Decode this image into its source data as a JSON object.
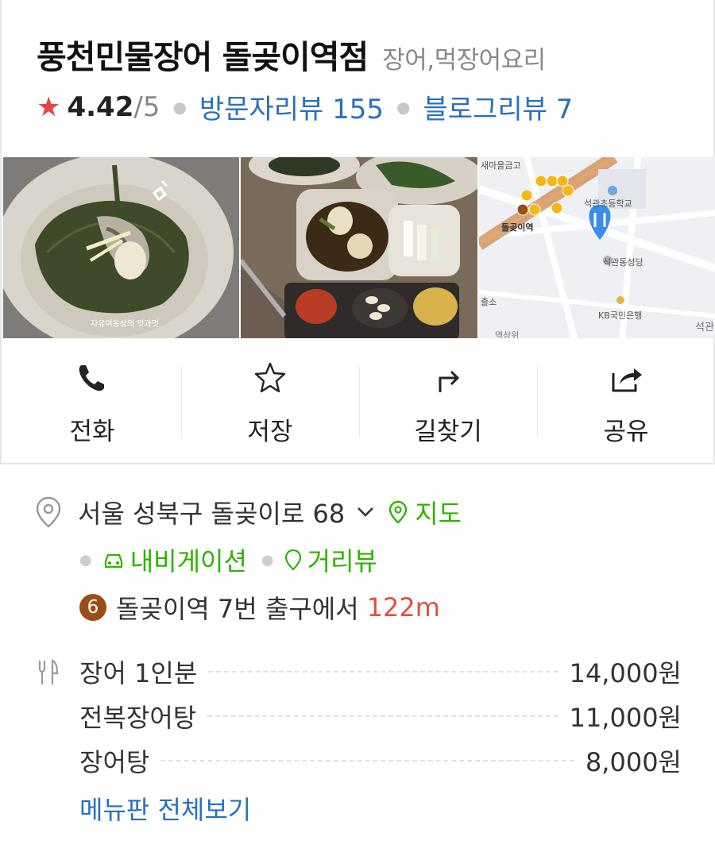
{
  "place": {
    "name": "풍천민물장어 돌곶이역점",
    "category": "장어,먹장어요리",
    "rating": "4.42",
    "rating_max": "/5",
    "visitor_reviews": "방문자리뷰 155",
    "blog_reviews": "블로그리뷰 7"
  },
  "photos": [
    {
      "caption": "자유여동상의 맛과멋"
    },
    {
      "caption": ""
    },
    {
      "map_labels": {
        "bank_top": "새마을금고",
        "school": "석관초등학교",
        "station": "돌곶이역",
        "church": "석관동성당",
        "bank": "KB국민은행",
        "exit": "출소",
        "edge": "석관",
        "bottom": "역삼위"
      }
    }
  ],
  "actions": [
    {
      "label": "전화",
      "icon": "phone-icon"
    },
    {
      "label": "저장",
      "icon": "star-outline-icon"
    },
    {
      "label": "길찾기",
      "icon": "directions-icon"
    },
    {
      "label": "공유",
      "icon": "share-icon"
    }
  ],
  "address": {
    "text": "서울 성북구 돌곶이로 68",
    "map_link": "지도",
    "navigation": "내비게이션",
    "street_view": "거리뷰",
    "subway_line": "6",
    "subway_text": "돌곶이역 7번 출구에서",
    "distance": "122m"
  },
  "menu": {
    "items": [
      {
        "name": "장어 1인분",
        "price": "14,000원"
      },
      {
        "name": "전복장어탕",
        "price": "11,000원"
      },
      {
        "name": "장어탕",
        "price": "8,000원"
      }
    ],
    "view_all": "메뉴판 전체보기"
  },
  "colors": {
    "accent_blue": "#2870c0",
    "accent_green": "#2db400",
    "star_red": "#e34546",
    "distance_red": "#e0503c",
    "line6_brown": "#9a4e16"
  }
}
